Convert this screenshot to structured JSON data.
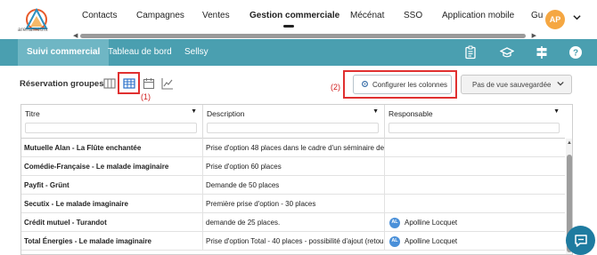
{
  "brand": {
    "logo_text": "arenametrix"
  },
  "nav": {
    "items": [
      "Contacts",
      "Campagnes",
      "Ventes",
      "Gestion commerciale",
      "Mécénat",
      "SSO",
      "Application mobile",
      "Gu"
    ],
    "active": "Gestion commerciale"
  },
  "user": {
    "initials": "AP"
  },
  "subnav": {
    "tabs": [
      "Suivi commercial",
      "Tableau de bord",
      "Sellsy"
    ],
    "active": "Suivi commercial"
  },
  "section": {
    "title": "Réservation groupes",
    "annotation_1": "(1)",
    "annotation_2": "(2)"
  },
  "toolbar": {
    "config_label": "Configurer les colonnes",
    "view_select": "Pas de vue sauvegardée"
  },
  "table": {
    "columns": [
      "Titre",
      "Description",
      "Responsable"
    ],
    "rows": [
      {
        "titre": "Mutuelle Alan - La Flûte enchantée",
        "description": "Prise d'option 48 places dans le cadre d'un séminaire des",
        "responsable": "",
        "initials": ""
      },
      {
        "titre": "Comédie-Française - Le malade imaginaire",
        "description": "Prise d'option 60 places",
        "responsable": "",
        "initials": ""
      },
      {
        "titre": "Payfit - Grünt",
        "description": "Demande de 50 places",
        "responsable": "",
        "initials": ""
      },
      {
        "titre": "Secutix - Le malade imaginaire",
        "description": "Première prise d'option - 30 places",
        "responsable": "",
        "initials": ""
      },
      {
        "titre": "Crédit mutuel - Turandot",
        "description": "demande de 25 places.",
        "responsable": "Apolline Locquet",
        "initials": "AL"
      },
      {
        "titre": "Total Énergies - Le malade imaginaire",
        "description": "Prise d'option Total - 40 places - possibilité d'ajout (retou",
        "responsable": "Apolline Locquet",
        "initials": "AL"
      }
    ]
  },
  "colors": {
    "subnav_bg": "#4a9fb0",
    "active_tab": "#6fb6c4",
    "highlight": "#e03030",
    "avatar": "#f5a742",
    "chat": "#1e7ba0"
  }
}
